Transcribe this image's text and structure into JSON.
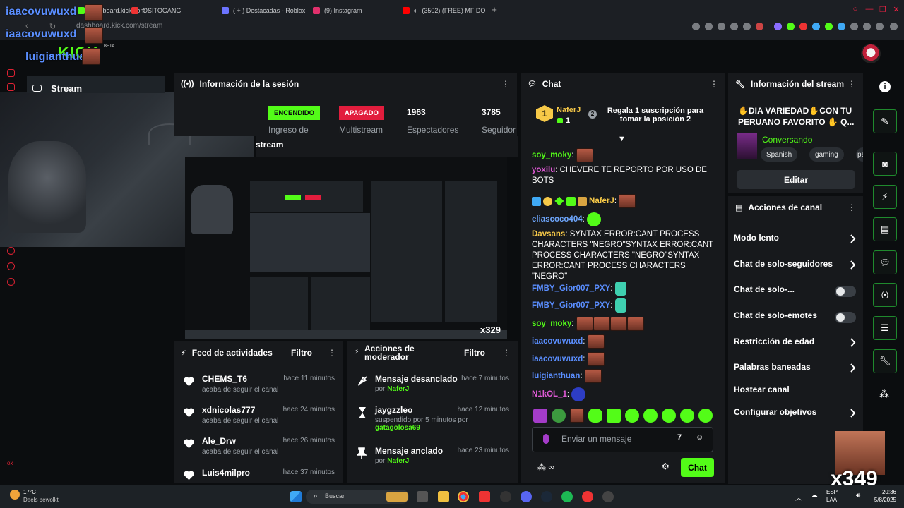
{
  "browser": {
    "tabs": [
      {
        "label": "dashboard.kick.com",
        "fav": "#53fc18"
      },
      {
        "label": "OSITOGANG",
        "fav": "#e33"
      },
      {
        "label": "( + ) Destacadas - Roblox",
        "fav": "#6c74ff"
      },
      {
        "label": "(9) Instagram",
        "fav": "#e1306c"
      },
      {
        "label": "(3502) (FREE) MF DO",
        "fav": "#f00"
      }
    ],
    "url": "dashboard.kick.com/stream"
  },
  "kick": {
    "logo": "KICK",
    "beta": "BETA"
  },
  "overlay_names": [
    "iaacovuwuxd",
    "iaacovuwuxd",
    "luigianthuan"
  ],
  "stream_label": "Stream",
  "session": {
    "title": "Información de la sesión",
    "badge_on": "ENCENDIDO",
    "badge_off": "APAGADO",
    "viewers": "1963",
    "viewers_label": "Espectadores",
    "followers": "3785",
    "followers_label": "Seguidor",
    "ingest_label": "Ingreso de",
    "multi_label": "Multistream"
  },
  "nested_label": "stream",
  "feed": {
    "title": "Feed de actividades",
    "filter": "Filtro",
    "items": [
      {
        "name": "CHEMS_T6",
        "time": "hace 11 minutos",
        "sub": "acaba de seguir el canal"
      },
      {
        "name": "xdnicolas777",
        "time": "hace 24 minutos",
        "sub": "acaba de seguir el canal"
      },
      {
        "name": "Ale_Drw",
        "time": "hace 26 minutos",
        "sub": "acaba de seguir el canal"
      },
      {
        "name": "Luis4milpro",
        "time": "hace 37 minutos",
        "sub": ""
      }
    ]
  },
  "mod": {
    "title_1": "Acciones de",
    "title_2": "moderador",
    "filter": "Filtro",
    "items": [
      {
        "name": "Mensaje desanclado",
        "time": "hace 7 minutos",
        "pre": "por",
        "by": "NaferJ"
      },
      {
        "name": "jaygzzleo",
        "time": "hace 12 minutos",
        "pre": "suspendido por 5 minutos por",
        "by": "gatagolosa69"
      },
      {
        "name": "Mensaje anclado",
        "time": "hace 23 minutos",
        "pre": "por",
        "by": "NaferJ"
      }
    ]
  },
  "chat": {
    "title": "Chat",
    "top_user": "NaferJ",
    "top_count": "1",
    "rank": "1",
    "rank2": "2",
    "gift_text": "Regala 1 suscripción para tomar la posición 2",
    "messages": [
      {
        "user": "soy_moky",
        "color": "#53fc18",
        "text": ""
      },
      {
        "user": "yoxilu",
        "color": "#e05ad6",
        "text": "CHEVERE TE REPORTO POR USO DE BOTS"
      },
      {
        "user": "NaferJ",
        "color": "#f7c948",
        "text": ""
      },
      {
        "user": "eliascoco404",
        "color": "#6fa8ff",
        "text": ""
      },
      {
        "user": "Davsans",
        "color": "#f7c948",
        "text": "SYNTAX ERROR:CANT PROCESS CHARACTERS \"NEGRO\"SYNTAX ERROR:CANT PROCESS CHARACTERS \"NEGRO\"SYNTAX ERROR:CANT PROCESS CHARACTERS \"NEGRO\""
      },
      {
        "user": "FMBY_Gior007_PXY",
        "color": "#5a8eff",
        "text": ""
      },
      {
        "user": "FMBY_Gior007_PXY",
        "color": "#5a8eff",
        "text": ""
      },
      {
        "user": "soy_moky",
        "color": "#53fc18",
        "text": ""
      },
      {
        "user": "iaacovuwuxd",
        "color": "#5a8eff",
        "text": ""
      },
      {
        "user": "iaacovuwuxd",
        "color": "#5a8eff",
        "text": ""
      },
      {
        "user": "luigianthuan",
        "color": "#5a8eff",
        "text": ""
      },
      {
        "user": "N1kOL_1",
        "color": "#e05ad6",
        "text": ""
      }
    ],
    "placeholder": "Enviar un mensaje",
    "send": "Chat"
  },
  "stream_info": {
    "title": "Información del stream",
    "stream_title": "✋DIA VARIEDAD✋CON TU PERUANO FAVORITO ✋ Q...",
    "category": "Conversando",
    "tags": [
      "Spanish",
      "gaming",
      "pe"
    ],
    "edit": "Editar"
  },
  "channel_actions": {
    "title": "Acciones de canal",
    "items": [
      {
        "label": "Modo lento",
        "kind": "chevron"
      },
      {
        "label": "Chat de solo-seguidores",
        "kind": "chevron"
      },
      {
        "label": "Chat de solo-...",
        "kind": "toggle"
      },
      {
        "label": "Chat de solo-emotes",
        "kind": "toggle"
      },
      {
        "label": "Restricción de edad",
        "kind": "chevron"
      },
      {
        "label": "Palabras baneadas",
        "kind": "chevron"
      },
      {
        "label": "Hostear canal",
        "kind": "none"
      },
      {
        "label": "Configurar objetivos",
        "kind": "chevron"
      }
    ]
  },
  "overlay_counter": "x349",
  "taskbar": {
    "weather": "17°C",
    "weather_sub": "Deels bewolkt",
    "search": "Buscar",
    "lang": "ESP",
    "lang2": "LAA",
    "time": "20:36",
    "date": "5/8/2025"
  }
}
